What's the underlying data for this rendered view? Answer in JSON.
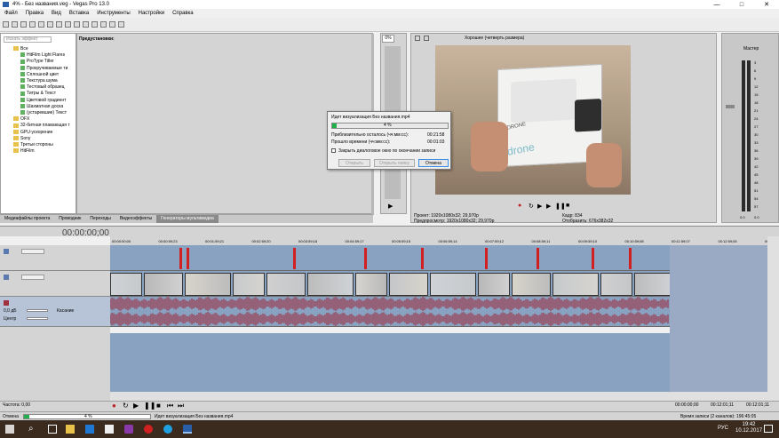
{
  "window": {
    "title": "4% - Без названия.veg - Vegas Pro 13.0",
    "min": "—",
    "max": "□",
    "close": "✕"
  },
  "menu": [
    "Файл",
    "Правка",
    "Вид",
    "Вставка",
    "Инструменты",
    "Настройки",
    "Справка"
  ],
  "explorer": {
    "search_placeholder": "Искать эффект",
    "items": [
      {
        "label": "Все",
        "type": "folder"
      },
      {
        "label": "HitFilm Light Flares",
        "type": "fx"
      },
      {
        "label": "ProType Titler",
        "type": "fx"
      },
      {
        "label": "Прокручиваемые ти",
        "type": "fx"
      },
      {
        "label": "Сплошной цвет",
        "type": "fx"
      },
      {
        "label": "Текстура шума",
        "type": "fx"
      },
      {
        "label": "Тестовый образец",
        "type": "fx"
      },
      {
        "label": "Титры & Текст",
        "type": "fx"
      },
      {
        "label": "Цветовой градиент",
        "type": "fx"
      },
      {
        "label": "Шахматная доска",
        "type": "fx"
      },
      {
        "label": "(устаревшие) Текст",
        "type": "fx"
      },
      {
        "label": "OFX",
        "type": "folder"
      },
      {
        "label": "32-битная плавающая т",
        "type": "folder"
      },
      {
        "label": "GPU-ускорение",
        "type": "folder"
      },
      {
        "label": "Sony",
        "type": "folder"
      },
      {
        "label": "Третьи стороны",
        "type": "folder"
      },
      {
        "label": "HitFilm",
        "type": "folder"
      }
    ]
  },
  "presets_title": "Предустановки:",
  "tabs": [
    {
      "label": "Медиафайлы проекта",
      "active": false
    },
    {
      "label": "Проводник",
      "active": false
    },
    {
      "label": "Переходы",
      "active": false
    },
    {
      "label": "Видеоэффекты",
      "active": false
    },
    {
      "label": "Генераторы мультимедиа",
      "active": true
    }
  ],
  "trimmer": {
    "zoom": "0%"
  },
  "preview": {
    "quality": "Хорошее (четверть размера)",
    "project_label": "Проект:",
    "project_value": "1920x1080x32; 29,970p",
    "preview_label": "Предпросмотр:",
    "preview_value": "1920x1080x32; 29,970p",
    "frame_label": "Кадр:",
    "frame_value": "834",
    "display_label": "Отобразить:",
    "display_value": "676x382x32",
    "box_text": "DRONE",
    "box_brand": "drone"
  },
  "mixer": {
    "title": "Мастер",
    "scale": [
      "3",
      "6",
      "9",
      "12",
      "15",
      "18",
      "21",
      "24",
      "27",
      "30",
      "33",
      "36",
      "39",
      "42",
      "45",
      "48",
      "51",
      "54",
      "57"
    ],
    "value_left": "0.0",
    "value_right": "0.0"
  },
  "dialog": {
    "title": "Идет визуализация Без названия.mp4",
    "progress_percent": 4,
    "progress_text": "4 %",
    "remaining_label": "Приблизительно осталось (чч:мм:сс):",
    "remaining_value": "00:21:58",
    "elapsed_label": "Прошло времени (чч:мм:сс):",
    "elapsed_value": "00:01:03",
    "checkbox_label": "Закрыть диалоговое окно по окончании записи",
    "btn_open": "Открыть",
    "btn_open_folder": "Открыть папку",
    "btn_cancel": "Отмена"
  },
  "timeline": {
    "timecode": "00:00:00;00",
    "ruler": [
      "00:00:00;00",
      "00:00:59;23",
      "00:01:59;21",
      "00:02:59;20",
      "00:03:59;18",
      "00:04:59;17",
      "00:05:59;15",
      "00:06:59;14",
      "00:07:59;12",
      "00:08:59;11",
      "00:09:59;10",
      "00:10:59;08",
      "00:11:59;07",
      "00:12:59;05",
      "00:13:59;04"
    ],
    "audio_track": {
      "volume": "0,0 дБ",
      "pan": "Центр",
      "mode": "Касание"
    }
  },
  "transport": {
    "rate": "Частота: 0,00",
    "time1": "00:00:00;00",
    "time2": "00:12:01;11",
    "time3": "00:12:01;11"
  },
  "status": {
    "cancel": "Отмена",
    "percent": "4 %",
    "task": "Идет визуализация Без названия.mp4",
    "record_time": "Время записи (2 каналов): 196:45:05"
  },
  "taskbar": {
    "lang": "РУС",
    "time": "19:42",
    "date": "10.12.2017"
  },
  "colors": {
    "accent": "#3a8ee6",
    "progress": "#21b04b",
    "marker": "#d02020",
    "track": "#8aa2c2",
    "waveform": "#a02030"
  }
}
